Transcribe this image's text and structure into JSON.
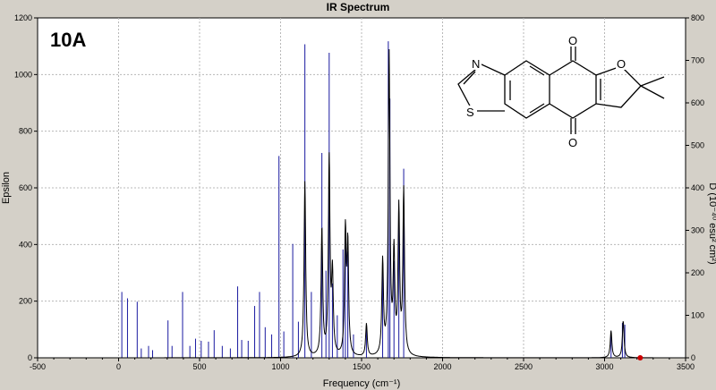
{
  "window": {
    "title": "IR Spectrum"
  },
  "chart_data": {
    "type": "line",
    "annotation": "10A",
    "xlabel": "Frequency (cm⁻¹)",
    "ylabel": "Epsilon",
    "y2label": "D (10⁻⁴⁰ esu² cm²)",
    "xlim": [
      -500,
      3500
    ],
    "ylim": [
      0,
      1200
    ],
    "y2lim": [
      0,
      800
    ],
    "xticks": [
      "-500",
      "0",
      "500",
      "1000",
      "1500",
      "2000",
      "2500",
      "3000",
      "3500"
    ],
    "yticks": [
      "0",
      "200",
      "400",
      "600",
      "800",
      "1000",
      "1200"
    ],
    "y2ticks": [
      "0",
      "100",
      "200",
      "300",
      "400",
      "500",
      "600",
      "700",
      "800"
    ],
    "grid": true,
    "line_color": "#000000",
    "stick_color": "#1a1aa0",
    "marker_color": "#cc0000",
    "sticks": [
      [
        20,
        155
      ],
      [
        55,
        140
      ],
      [
        115,
        132
      ],
      [
        140,
        22
      ],
      [
        185,
        28
      ],
      [
        210,
        18
      ],
      [
        305,
        88
      ],
      [
        330,
        28
      ],
      [
        395,
        155
      ],
      [
        440,
        28
      ],
      [
        475,
        45
      ],
      [
        510,
        40
      ],
      [
        555,
        38
      ],
      [
        590,
        65
      ],
      [
        640,
        28
      ],
      [
        690,
        22
      ],
      [
        735,
        168
      ],
      [
        760,
        42
      ],
      [
        800,
        40
      ],
      [
        840,
        122
      ],
      [
        870,
        155
      ],
      [
        905,
        72
      ],
      [
        945,
        55
      ],
      [
        990,
        475
      ],
      [
        1020,
        62
      ],
      [
        1075,
        268
      ],
      [
        1110,
        85
      ],
      [
        1150,
        738
      ],
      [
        1190,
        155
      ],
      [
        1255,
        482
      ],
      [
        1280,
        205
      ],
      [
        1300,
        718
      ],
      [
        1320,
        175
      ],
      [
        1350,
        100
      ],
      [
        1385,
        255
      ],
      [
        1400,
        280
      ],
      [
        1415,
        250
      ],
      [
        1450,
        55
      ],
      [
        1530,
        72
      ],
      [
        1630,
        228
      ],
      [
        1665,
        745
      ],
      [
        1675,
        610
      ],
      [
        1700,
        228
      ],
      [
        1730,
        345
      ],
      [
        1760,
        445
      ],
      [
        3040,
        62
      ],
      [
        3110,
        82
      ],
      [
        3125,
        78
      ]
    ],
    "envelope": [
      [
        1150,
        620
      ],
      [
        1255,
        450
      ],
      [
        1300,
        690
      ],
      [
        1320,
        280
      ],
      [
        1400,
        430
      ],
      [
        1415,
        380
      ],
      [
        1530,
        115
      ],
      [
        1630,
        330
      ],
      [
        1670,
        1060
      ],
      [
        1700,
        350
      ],
      [
        1730,
        510
      ],
      [
        1760,
        580
      ],
      [
        3040,
        95
      ],
      [
        3115,
        130
      ]
    ],
    "marker": [
      3220,
      0
    ]
  },
  "molecule": {
    "atoms": {
      "n": "N",
      "s": "S",
      "o_furan": "O",
      "o_top": "O",
      "o_bottom": "O"
    }
  }
}
